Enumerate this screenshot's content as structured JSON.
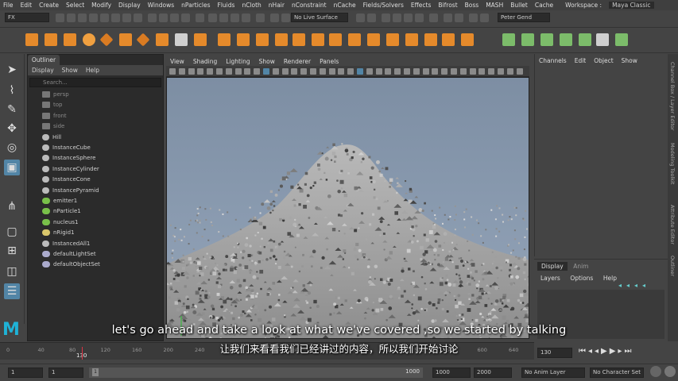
{
  "menubar": {
    "items": [
      "File",
      "Edit",
      "Create",
      "Select",
      "Modify",
      "Display",
      "Windows",
      "nParticles",
      "Fluids",
      "nCloth",
      "nHair",
      "nConstraint",
      "nCache",
      "Fields/Solvers",
      "Effects",
      "Bifrost",
      "Boss",
      "MASH",
      "Bullet",
      "Cache"
    ],
    "workspace_label": "Workspace :",
    "workspace_value": "Maya Classic"
  },
  "statusline": {
    "menuset": "FX",
    "live_surface": "No Live Surface",
    "user": "Peter Gend"
  },
  "outliner": {
    "tab": "Outliner",
    "menu": [
      "Display",
      "Show",
      "Help"
    ],
    "search_placeholder": "Search...",
    "items": [
      {
        "label": "persp",
        "icon": "camera-icon"
      },
      {
        "label": "top",
        "icon": "camera-icon"
      },
      {
        "label": "front",
        "icon": "camera-icon"
      },
      {
        "label": "side",
        "icon": "camera-icon"
      },
      {
        "label": "Hill",
        "icon": "mesh-icon"
      },
      {
        "label": "InstanceCube",
        "icon": "group-icon"
      },
      {
        "label": "InstanceSphere",
        "icon": "group-icon"
      },
      {
        "label": "InstanceCylinder",
        "icon": "group-icon"
      },
      {
        "label": "InstanceCone",
        "icon": "group-icon"
      },
      {
        "label": "InstancePyramid",
        "icon": "group-icon"
      },
      {
        "label": "emitter1",
        "icon": "emitter-icon"
      },
      {
        "label": "nParticle1",
        "icon": "particle-icon"
      },
      {
        "label": "nucleus1",
        "icon": "nucleus-icon"
      },
      {
        "label": "nRigid1",
        "icon": "rigid-icon"
      },
      {
        "label": "InstancedAll1",
        "icon": "instancer-icon"
      },
      {
        "label": "defaultLightSet",
        "icon": "set-icon"
      },
      {
        "label": "defaultObjectSet",
        "icon": "set-icon"
      }
    ]
  },
  "viewport": {
    "menu": [
      "View",
      "Shading",
      "Lighting",
      "Show",
      "Renderer",
      "Panels"
    ]
  },
  "channelbox": {
    "menu": [
      "Channels",
      "Edit",
      "Object",
      "Show"
    ]
  },
  "layers": {
    "tabs": [
      "Display",
      "Anim"
    ],
    "menu": [
      "Layers",
      "Options",
      "Help"
    ]
  },
  "sidetabs": [
    "Channel Box / Layer Editor",
    "Modeling Toolkit",
    "Attribute Editor",
    "Outliner"
  ],
  "timeslider": {
    "ticks": [
      "0",
      "40",
      "80",
      "120",
      "160",
      "200",
      "240",
      "280",
      "320",
      "360",
      "400",
      "440",
      "480",
      "520",
      "560",
      "600",
      "640"
    ],
    "current_frame_marker": "130",
    "current_frame": "130"
  },
  "rangebar": {
    "start_frame": "1",
    "anim_start": "1",
    "range_start_handle": "1",
    "range_end": "1000",
    "anim_end": "1000",
    "playback_end": "2000",
    "anim_layer": "No Anim Layer",
    "character_set": "No Character Set"
  },
  "subtitles": {
    "english": "let's go ahead and take a look at what we've covered ,so we started by talking",
    "chinese": "让我们来看看我们已经讲过的内容，所以我们开始讨论"
  },
  "logo": "M"
}
